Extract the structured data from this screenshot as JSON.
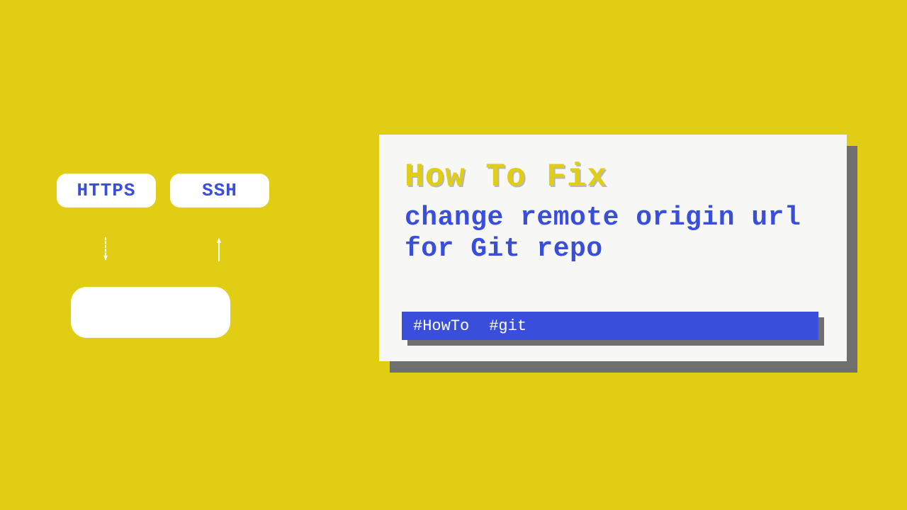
{
  "diagram": {
    "https_label": "HTTPS",
    "ssh_label": "SSH"
  },
  "card": {
    "title": "How To Fix",
    "subtitle": "change remote origin url for Git repo",
    "tags": [
      "#HowTo",
      "#git"
    ]
  },
  "colors": {
    "bg": "#e0cd14",
    "accent": "#3a4edc",
    "card_bg": "#f7f7f5",
    "shadow": "#6f6f6f"
  }
}
